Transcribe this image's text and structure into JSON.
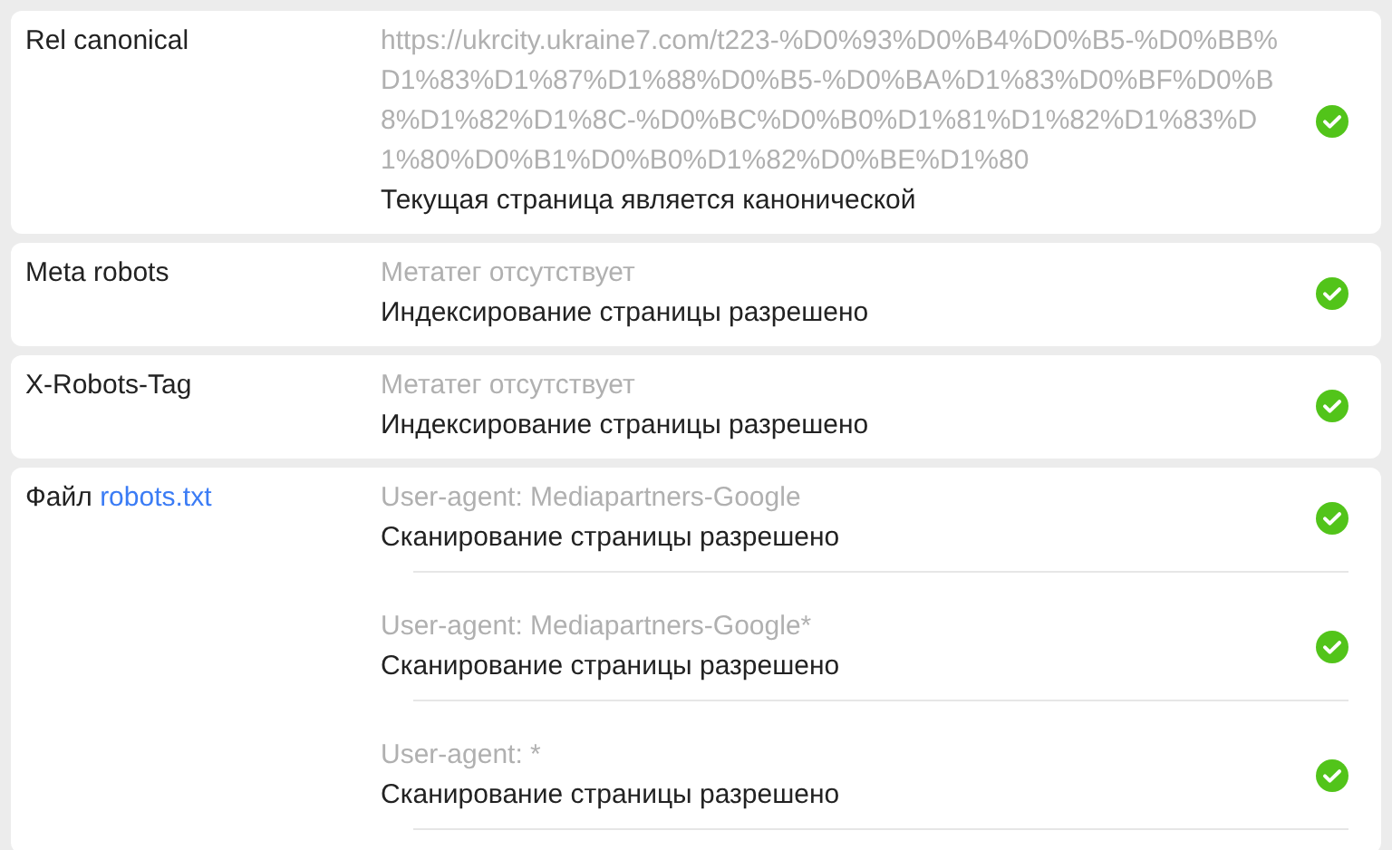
{
  "sections": [
    {
      "label": "Rel canonical",
      "items": [
        {
          "detail": "https://ukrcity.ukraine7.com/t223-%D0%93%D0%B4%D0%B5-%D0%BB%D1%83%D1%87%D1%88%D0%B5-%D0%BA%D1%83%D0%BF%D0%B8%D1%82%D1%8C-%D0%BC%D0%B0%D1%81%D1%82%D1%83%D1%80%D0%B1%D0%B0%D1%82%D0%BE%D1%80",
          "result": "Текущая страница является канонической",
          "passed": true
        }
      ]
    },
    {
      "label": "Meta robots",
      "items": [
        {
          "detail": "Метатег отсутствует",
          "result": "Индексирование страницы разрешено",
          "passed": true
        }
      ]
    },
    {
      "label": "X-Robots-Tag",
      "items": [
        {
          "detail": "Метатег отсутствует",
          "result": "Индексирование страницы разрешено",
          "passed": true
        }
      ]
    },
    {
      "label": "Файл",
      "link": "robots.txt",
      "items": [
        {
          "detail": "User-agent: Mediapartners-Google",
          "result": "Сканирование страницы разрешено",
          "passed": true
        },
        {
          "detail": "User-agent: Mediapartners-Google*",
          "result": "Сканирование страницы разрешено",
          "passed": true
        },
        {
          "detail": "User-agent: *",
          "result": "Сканирование страницы разрешено",
          "passed": true
        }
      ]
    }
  ]
}
